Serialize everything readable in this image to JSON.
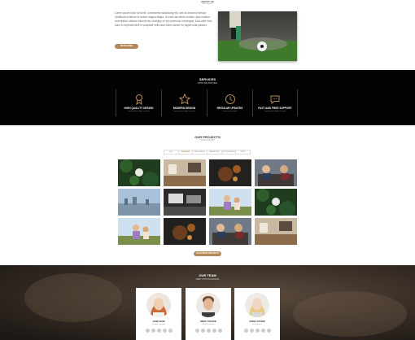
{
  "about": {
    "kicker": "ABOUT US",
    "kicker_sub": "WHO WE ARE",
    "text": "Lorem ipsum dolor sit amet, consectetur adipisicing elit, sed do eiusmod tempor incididunt ut labore et dolore magna aliqua. Ut enim ad minim veniam, quis nostrud exercitation ullamco laboris nisi ut aliquip ex ea commodo consequat. Duis aute irure dolor in reprehenderit in voluptate velit esse cillum dolore eu fugiat nulla pariatur.",
    "button_label": "READ MORE",
    "photo_icon": "soccer-photo"
  },
  "services": {
    "title": "SERVICES",
    "subtitle": "WHAT WE PROVIDE",
    "items": [
      {
        "icon": "award-icon",
        "name": "HIGH QUALITY DESIGN",
        "desc": "Lorem ipsum dolor sit amet"
      },
      {
        "icon": "star-icon",
        "name": "MODERN DESIGN",
        "desc": "Lorem ipsum dolor sit amet"
      },
      {
        "icon": "clock-icon",
        "name": "REGULAR UPDATES",
        "desc": "Lorem ipsum dolor"
      },
      {
        "icon": "chat-icon",
        "name": "FAST AND FREE SUPPORT",
        "desc": "Lorem ipsum dolor sit amet"
      }
    ]
  },
  "projects": {
    "title": "OUR PROJECTS",
    "subtitle": "WHAT WE DID",
    "filters": [
      "ALL",
      "BRANDING",
      "WEB DESIGN",
      "MARKETING",
      "PHOTOGRAPHY",
      "PRINT"
    ],
    "active_filter": "BRANDING",
    "tiles": [
      "plant",
      "office",
      "food",
      "meeting",
      "city",
      "workspace",
      "celebration",
      "plant",
      "celebration",
      "food",
      "meeting",
      "office"
    ],
    "more_label": "LOAD MORE PROJECTS"
  },
  "team": {
    "title": "OUR TEAM",
    "subtitle": "MEET OUR DESIGNERS",
    "members": [
      {
        "name": "JANE DOE",
        "role": "Graphic Designer",
        "avatar": "woman-redhead"
      },
      {
        "name": "MIKE CRUISE",
        "role": "Web Developer",
        "avatar": "man-brown"
      },
      {
        "name": "ANNA STONE",
        "role": "Art Director",
        "avatar": "woman-blonde"
      }
    ]
  },
  "colors": {
    "accent": "#b38b59",
    "dark": "#020202"
  }
}
